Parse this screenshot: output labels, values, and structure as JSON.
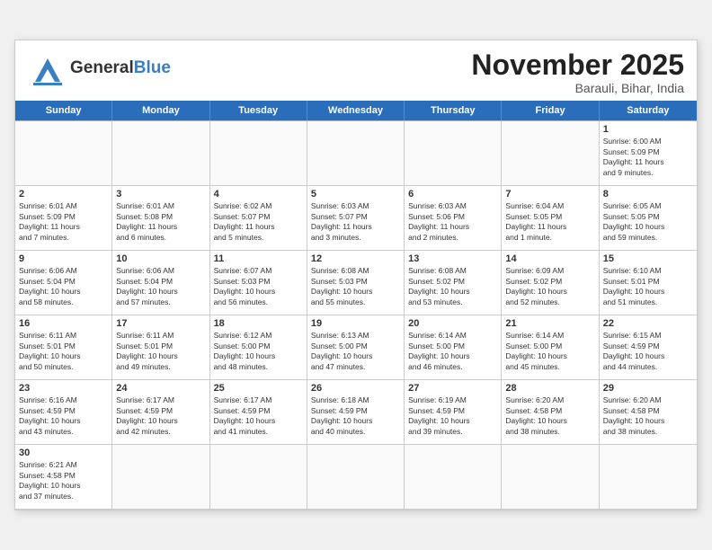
{
  "header": {
    "logo_general": "General",
    "logo_blue": "Blue",
    "month": "November 2025",
    "location": "Barauli, Bihar, India"
  },
  "days": [
    "Sunday",
    "Monday",
    "Tuesday",
    "Wednesday",
    "Thursday",
    "Friday",
    "Saturday"
  ],
  "cells": [
    {
      "day": null,
      "empty": true
    },
    {
      "day": null,
      "empty": true
    },
    {
      "day": null,
      "empty": true
    },
    {
      "day": null,
      "empty": true
    },
    {
      "day": null,
      "empty": true
    },
    {
      "day": null,
      "empty": true
    },
    {
      "day": 1,
      "info": "Sunrise: 6:00 AM\nSunset: 5:09 PM\nDaylight: 11 hours\nand 9 minutes."
    },
    {
      "day": 2,
      "info": "Sunrise: 6:01 AM\nSunset: 5:09 PM\nDaylight: 11 hours\nand 7 minutes."
    },
    {
      "day": 3,
      "info": "Sunrise: 6:01 AM\nSunset: 5:08 PM\nDaylight: 11 hours\nand 6 minutes."
    },
    {
      "day": 4,
      "info": "Sunrise: 6:02 AM\nSunset: 5:07 PM\nDaylight: 11 hours\nand 5 minutes."
    },
    {
      "day": 5,
      "info": "Sunrise: 6:03 AM\nSunset: 5:07 PM\nDaylight: 11 hours\nand 3 minutes."
    },
    {
      "day": 6,
      "info": "Sunrise: 6:03 AM\nSunset: 5:06 PM\nDaylight: 11 hours\nand 2 minutes."
    },
    {
      "day": 7,
      "info": "Sunrise: 6:04 AM\nSunset: 5:05 PM\nDaylight: 11 hours\nand 1 minute."
    },
    {
      "day": 8,
      "info": "Sunrise: 6:05 AM\nSunset: 5:05 PM\nDaylight: 10 hours\nand 59 minutes."
    },
    {
      "day": 9,
      "info": "Sunrise: 6:06 AM\nSunset: 5:04 PM\nDaylight: 10 hours\nand 58 minutes."
    },
    {
      "day": 10,
      "info": "Sunrise: 6:06 AM\nSunset: 5:04 PM\nDaylight: 10 hours\nand 57 minutes."
    },
    {
      "day": 11,
      "info": "Sunrise: 6:07 AM\nSunset: 5:03 PM\nDaylight: 10 hours\nand 56 minutes."
    },
    {
      "day": 12,
      "info": "Sunrise: 6:08 AM\nSunset: 5:03 PM\nDaylight: 10 hours\nand 55 minutes."
    },
    {
      "day": 13,
      "info": "Sunrise: 6:08 AM\nSunset: 5:02 PM\nDaylight: 10 hours\nand 53 minutes."
    },
    {
      "day": 14,
      "info": "Sunrise: 6:09 AM\nSunset: 5:02 PM\nDaylight: 10 hours\nand 52 minutes."
    },
    {
      "day": 15,
      "info": "Sunrise: 6:10 AM\nSunset: 5:01 PM\nDaylight: 10 hours\nand 51 minutes."
    },
    {
      "day": 16,
      "info": "Sunrise: 6:11 AM\nSunset: 5:01 PM\nDaylight: 10 hours\nand 50 minutes."
    },
    {
      "day": 17,
      "info": "Sunrise: 6:11 AM\nSunset: 5:01 PM\nDaylight: 10 hours\nand 49 minutes."
    },
    {
      "day": 18,
      "info": "Sunrise: 6:12 AM\nSunset: 5:00 PM\nDaylight: 10 hours\nand 48 minutes."
    },
    {
      "day": 19,
      "info": "Sunrise: 6:13 AM\nSunset: 5:00 PM\nDaylight: 10 hours\nand 47 minutes."
    },
    {
      "day": 20,
      "info": "Sunrise: 6:14 AM\nSunset: 5:00 PM\nDaylight: 10 hours\nand 46 minutes."
    },
    {
      "day": 21,
      "info": "Sunrise: 6:14 AM\nSunset: 5:00 PM\nDaylight: 10 hours\nand 45 minutes."
    },
    {
      "day": 22,
      "info": "Sunrise: 6:15 AM\nSunset: 4:59 PM\nDaylight: 10 hours\nand 44 minutes."
    },
    {
      "day": 23,
      "info": "Sunrise: 6:16 AM\nSunset: 4:59 PM\nDaylight: 10 hours\nand 43 minutes."
    },
    {
      "day": 24,
      "info": "Sunrise: 6:17 AM\nSunset: 4:59 PM\nDaylight: 10 hours\nand 42 minutes."
    },
    {
      "day": 25,
      "info": "Sunrise: 6:17 AM\nSunset: 4:59 PM\nDaylight: 10 hours\nand 41 minutes."
    },
    {
      "day": 26,
      "info": "Sunrise: 6:18 AM\nSunset: 4:59 PM\nDaylight: 10 hours\nand 40 minutes."
    },
    {
      "day": 27,
      "info": "Sunrise: 6:19 AM\nSunset: 4:59 PM\nDaylight: 10 hours\nand 39 minutes."
    },
    {
      "day": 28,
      "info": "Sunrise: 6:20 AM\nSunset: 4:58 PM\nDaylight: 10 hours\nand 38 minutes."
    },
    {
      "day": 29,
      "info": "Sunrise: 6:20 AM\nSunset: 4:58 PM\nDaylight: 10 hours\nand 38 minutes."
    },
    {
      "day": 30,
      "info": "Sunrise: 6:21 AM\nSunset: 4:58 PM\nDaylight: 10 hours\nand 37 minutes."
    },
    {
      "day": null,
      "empty": true
    },
    {
      "day": null,
      "empty": true
    },
    {
      "day": null,
      "empty": true
    },
    {
      "day": null,
      "empty": true
    },
    {
      "day": null,
      "empty": true
    },
    {
      "day": null,
      "empty": true
    }
  ]
}
